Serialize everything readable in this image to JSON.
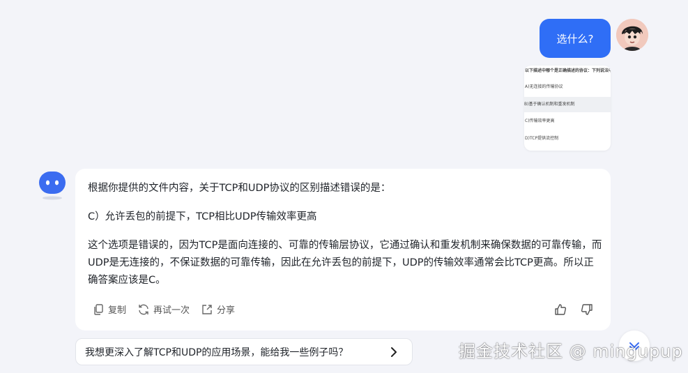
{
  "user_message": {
    "text": "选什么?"
  },
  "attachment_preview": {
    "lines": [
      "以下描述中哪个是正确描述的协议：下列说法中,",
      "A)无连接的传输协议",
      "B)基于确认机制和重发机制",
      "C)传输效率更高",
      "D)TCP提供流控制"
    ]
  },
  "answer": {
    "intro": "根据你提供的文件内容，关于TCP和UDP协议的区别描述错误的是：",
    "option": "C）允许丢包的前提下，TCP相比UDP传输效率更高",
    "explanation": "这个选项是错误的，因为TCP是面向连接的、可靠的传输层协议，它通过确认和重发机制来确保数据的可靠传输，而UDP是无连接的，不保证数据的可靠传输，因此在允许丢包的前提下，UDP的传输效率通常会比TCP更高。所以正确答案应该是C。"
  },
  "actions": {
    "copy": "复制",
    "retry": "再试一次",
    "share": "分享"
  },
  "suggestion": {
    "text": "我想更深入了解TCP和UDP的应用场景，能给我一些例子吗？"
  },
  "watermark": {
    "text": "掘金技术社区 @ mingupup"
  },
  "colors": {
    "accent": "#2f6ef6",
    "bot": "#3b6cf0"
  }
}
